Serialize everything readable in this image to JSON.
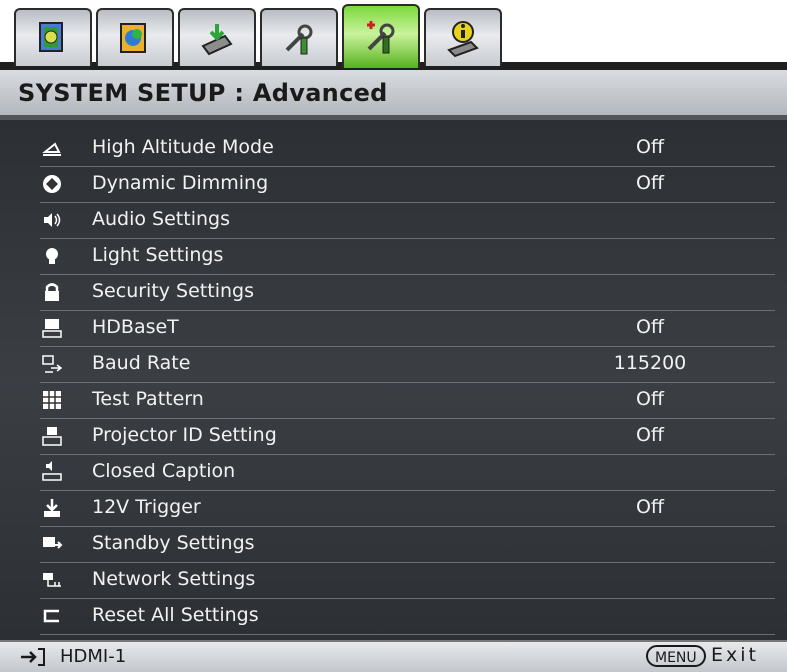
{
  "tabs": [
    {
      "icon": "picture-icon",
      "active": false
    },
    {
      "icon": "color-picture-icon",
      "active": false
    },
    {
      "icon": "source-input-icon",
      "active": false
    },
    {
      "icon": "system-setup-basic-icon",
      "active": false
    },
    {
      "icon": "system-setup-advanced-icon",
      "active": true
    },
    {
      "icon": "information-icon",
      "active": false
    }
  ],
  "title": "SYSTEM SETUP : Advanced",
  "menu": [
    {
      "icon": "high-altitude-icon",
      "label": "High Altitude Mode",
      "value": "Off"
    },
    {
      "icon": "dynamic-dimming-icon",
      "label": "Dynamic Dimming",
      "value": "Off"
    },
    {
      "icon": "audio-icon",
      "label": "Audio Settings",
      "value": ""
    },
    {
      "icon": "light-bulb-icon",
      "label": "Light Settings",
      "value": ""
    },
    {
      "icon": "lock-icon",
      "label": "Security Settings",
      "value": ""
    },
    {
      "icon": "hdbaset-icon",
      "label": "HDBaseT",
      "value": "Off"
    },
    {
      "icon": "baud-rate-icon",
      "label": "Baud Rate",
      "value": "115200"
    },
    {
      "icon": "test-pattern-icon",
      "label": "Test Pattern",
      "value": "Off"
    },
    {
      "icon": "projector-id-icon",
      "label": "Projector ID Setting",
      "value": "Off"
    },
    {
      "icon": "closed-caption-icon",
      "label": "Closed Caption",
      "value": ""
    },
    {
      "icon": "trigger-icon",
      "label": "12V Trigger",
      "value": "Off"
    },
    {
      "icon": "standby-icon",
      "label": "Standby Settings",
      "value": ""
    },
    {
      "icon": "network-icon",
      "label": "Network Settings",
      "value": ""
    },
    {
      "icon": "reset-icon",
      "label": "Reset All Settings",
      "value": ""
    }
  ],
  "footer": {
    "source_icon": "input-source-icon",
    "source": "HDMI-1",
    "menu_key": "MENU",
    "exit": "Exit"
  },
  "colors": {
    "active_tab": "#7cd83d",
    "menu_background": "#33363b",
    "menu_text": "#f2f2f2"
  }
}
